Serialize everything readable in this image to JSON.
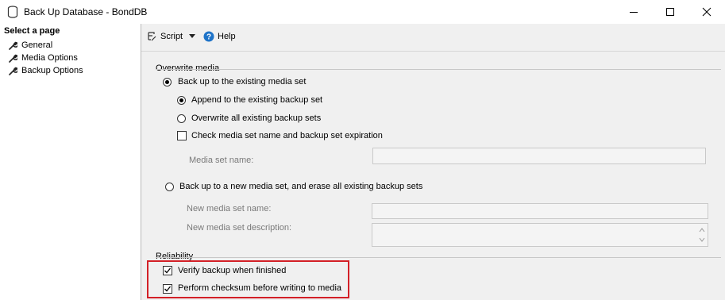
{
  "window": {
    "title": "Back Up Database - BondDB",
    "icon": "database-icon"
  },
  "sidebar": {
    "header": "Select a page",
    "items": [
      {
        "label": "General",
        "icon": "wrench-icon"
      },
      {
        "label": "Media Options",
        "icon": "wrench-icon"
      },
      {
        "label": "Backup Options",
        "icon": "wrench-icon"
      }
    ]
  },
  "toolbar": {
    "script_label": "Script",
    "help_label": "Help"
  },
  "overwrite": {
    "section_title": "Overwrite media",
    "existing_set_label": "Back up to the existing media set",
    "append_label": "Append to the existing backup set",
    "overwrite_all_label": "Overwrite all existing backup sets",
    "check_name_label": "Check media set name and backup set expiration",
    "media_set_name_label": "Media set name:",
    "media_set_name_value": "",
    "new_set_label": "Back up to a new media set, and erase all existing backup sets",
    "new_name_label": "New media set name:",
    "new_name_value": "",
    "new_desc_label": "New media set description:",
    "new_desc_value": ""
  },
  "reliability": {
    "section_title": "Reliability",
    "verify_label": "Verify backup when finished",
    "checksum_label": "Perform checksum before writing to media"
  },
  "state": {
    "existing_set_selected": true,
    "append_selected": true,
    "overwrite_all_selected": false,
    "check_name_checked": false,
    "new_set_selected": false,
    "verify_checked": true,
    "checksum_checked": true
  },
  "colors": {
    "highlight_border": "#d32027",
    "help_icon": "#1e73c8"
  }
}
